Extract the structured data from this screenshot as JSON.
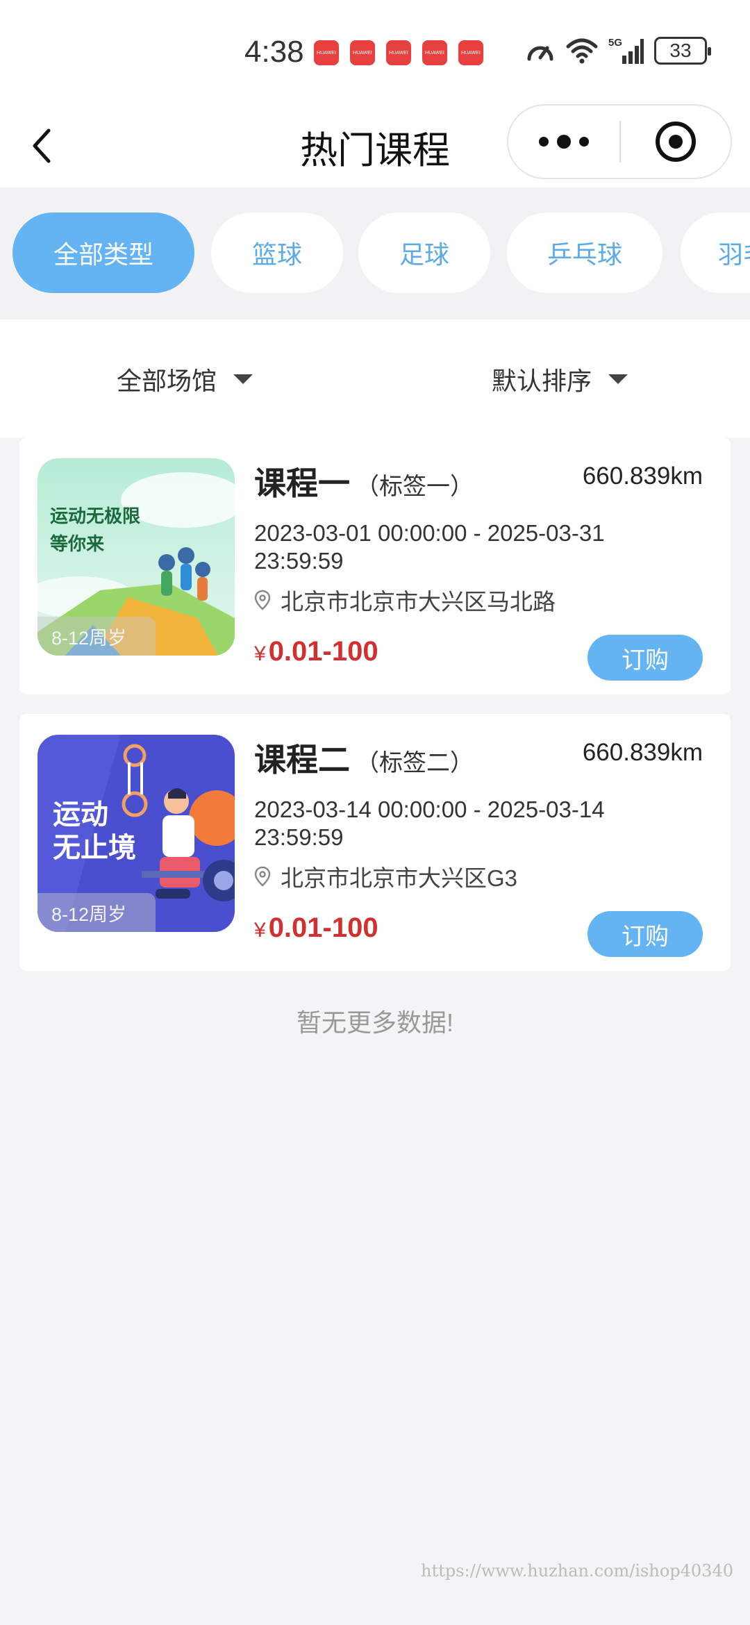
{
  "status_bar": {
    "time": "4:38",
    "notification_icon_text": "HUAWEI",
    "battery": "33",
    "network": "5G"
  },
  "nav": {
    "title": "热门课程"
  },
  "tabs": [
    {
      "label": "全部类型",
      "active": true
    },
    {
      "label": "篮球",
      "active": false
    },
    {
      "label": "足球",
      "active": false
    },
    {
      "label": "乒乓球",
      "active": false
    },
    {
      "label": "羽毛球",
      "active": false
    }
  ],
  "filters": {
    "venue": "全部场馆",
    "sort": "默认排序"
  },
  "courses": [
    {
      "name": "课程一",
      "tag": "（标签一）",
      "distance": "660.839km",
      "time": "2023-03-01 00:00:00 - 2025-03-31 23:59:59",
      "address": "北京市北京市大兴区马北路",
      "currency": "¥",
      "price": "0.01-100",
      "buy_label": "订购",
      "age_label": "8-12周岁",
      "image_text_1": "运动无极限",
      "image_text_2": "等你来"
    },
    {
      "name": "课程二",
      "tag": "（标签二）",
      "distance": "660.839km",
      "time": "2023-03-14 00:00:00 - 2025-03-14 23:59:59",
      "address": "北京市北京市大兴区G3",
      "currency": "¥",
      "price": "0.01-100",
      "buy_label": "订购",
      "age_label": "8-12周岁",
      "image_text_1": "运动",
      "image_text_2": "无止境"
    }
  ],
  "footer": {
    "no_more": "暂无更多数据!",
    "watermark": "https://www.huzhan.com/ishop40340"
  },
  "colors": {
    "accent": "#64b4f4",
    "tab_text": "#5aabe8",
    "price": "#d23030",
    "background": "#f4f4f6"
  }
}
